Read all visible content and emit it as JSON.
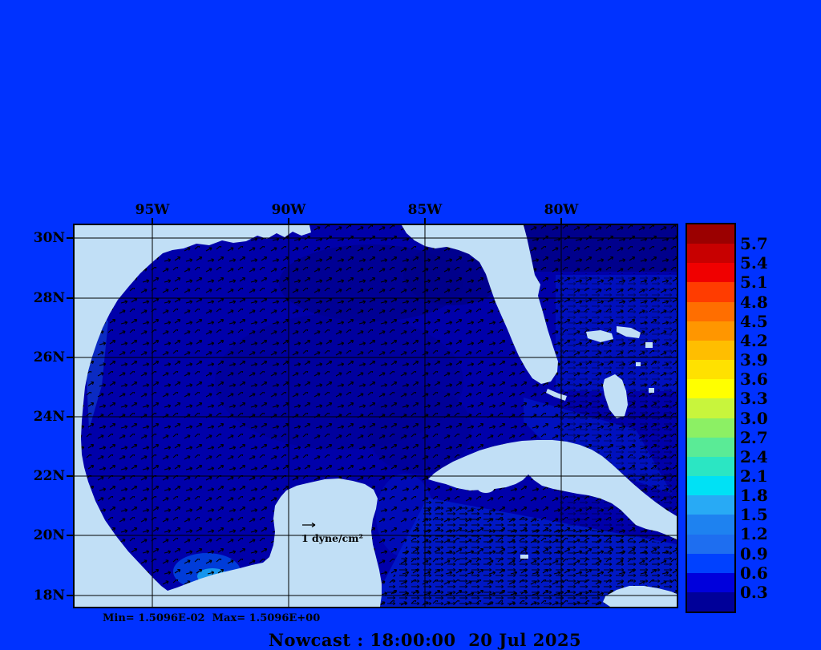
{
  "title": "Nowcast : 18:00:00  20 Jul 2025",
  "stats": "Min= 1.5096E-02  Max= 1.5096E+00",
  "map": {
    "scale_label": "1 dyne/cm²",
    "lat_labels": [
      "30N",
      "28N",
      "26N",
      "24N",
      "22N",
      "20N",
      "18N"
    ],
    "lon_labels": [
      "95W",
      "90W",
      "85W",
      "80W"
    ]
  },
  "colorbar": {
    "tick_labels": [
      "5.7",
      "5.4",
      "5.1",
      "4.8",
      "4.5",
      "4.2",
      "3.9",
      "3.6",
      "3.3",
      "3.0",
      "2.7",
      "2.4",
      "2.1",
      "1.8",
      "1.5",
      "1.2",
      "0.9",
      "0.6",
      "0.3"
    ],
    "colors": [
      "#9B0000",
      "#C80000",
      "#F00000",
      "#FF3C00",
      "#FF6E00",
      "#FF9600",
      "#FFBE00",
      "#FFE100",
      "#FFFF00",
      "#C8F53C",
      "#8CF064",
      "#5AEB96",
      "#2BE6C3",
      "#00E1F5",
      "#28AAF5",
      "#1E82F0",
      "#1E6EF0",
      "#0041FF",
      "#0000DC",
      "#000099"
    ]
  },
  "colors": {
    "background": "#0032FF",
    "land": "#C1DFF6",
    "water": "#0000AA",
    "grid": "#000000"
  }
}
